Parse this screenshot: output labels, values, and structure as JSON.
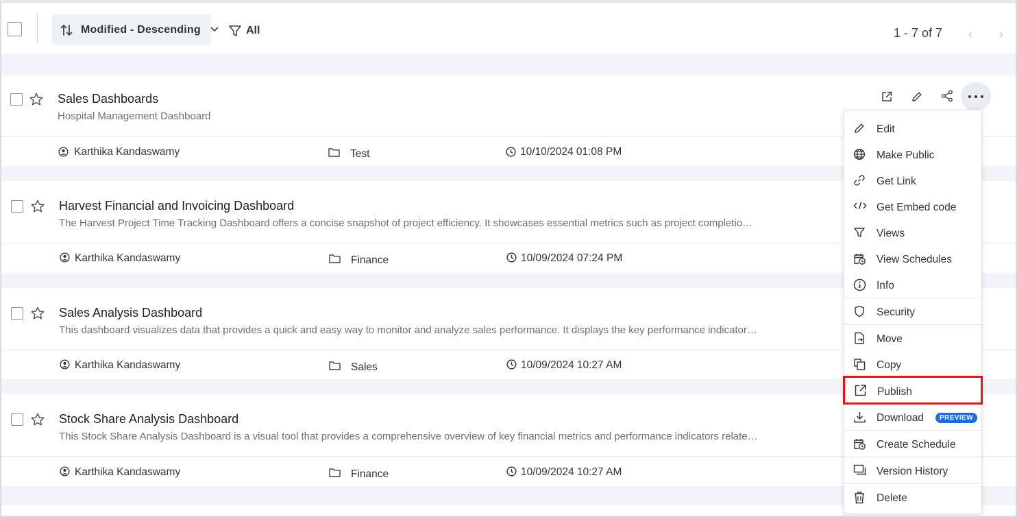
{
  "toolbar": {
    "sort_label": "Modified - Descending",
    "filter_label": "All",
    "pager_text": "1 - 7 of 7"
  },
  "items": [
    {
      "title": "Sales Dashboards",
      "description": "Hospital Management Dashboard",
      "owner": "Karthika Kandaswamy",
      "category": "Test",
      "modified": "10/10/2024 01:08 PM"
    },
    {
      "title": "Harvest Financial and Invoicing Dashboard",
      "description": "The Harvest Project Time Tracking Dashboard offers a concise snapshot of project efficiency. It showcases essential metrics such as project completio…",
      "owner": "Karthika Kandaswamy",
      "category": "Finance",
      "modified": "10/09/2024 07:24 PM"
    },
    {
      "title": "Sales Analysis Dashboard",
      "description": "This dashboard visualizes data that provides a quick and easy way to monitor and analyze sales performance. It displays the key performance indicator…",
      "owner": "Karthika Kandaswamy",
      "category": "Sales",
      "modified": "10/09/2024 10:27 AM"
    },
    {
      "title": "Stock Share Analysis Dashboard",
      "description": "This Stock Share Analysis Dashboard is a visual tool that provides a comprehensive overview of key financial metrics and performance indicators relate…",
      "owner": "Karthika Kandaswamy",
      "category": "Finance",
      "modified": "10/09/2024 10:27 AM"
    }
  ],
  "menu": {
    "edit": "Edit",
    "make_public": "Make Public",
    "get_link": "Get Link",
    "get_embed_code": "Get Embed code",
    "views": "Views",
    "view_schedules": "View Schedules",
    "info": "Info",
    "security": "Security",
    "move": "Move",
    "copy": "Copy",
    "publish": "Publish",
    "download": "Download",
    "download_badge": "PREVIEW",
    "create_schedule": "Create Schedule",
    "version_history": "Version History",
    "delete": "Delete"
  },
  "colors": {
    "highlight_border": "#e0141e",
    "badge": "#1e6bdc",
    "band": "#f2f4f7",
    "sort_bg": "#eef2f8"
  }
}
